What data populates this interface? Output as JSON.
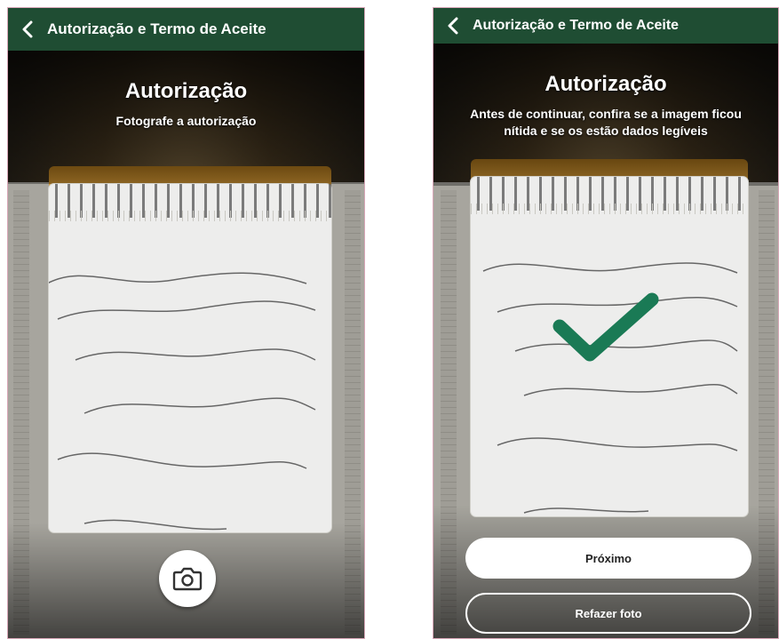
{
  "colors": {
    "header": "#1f4d33",
    "check": "#1a7a55"
  },
  "left_screen": {
    "header": {
      "title": "Autorização e Termo de Aceite",
      "back_icon": "chevron-left-icon"
    },
    "title": "Autorização",
    "subtitle": "Fotografe a autorização",
    "camera_icon": "camera-icon"
  },
  "right_screen": {
    "header": {
      "title": "Autorização e Termo de Aceite",
      "back_icon": "chevron-left-icon"
    },
    "title": "Autorização",
    "subtitle_line1": "Antes de continuar, confira se a imagem ficou",
    "subtitle_line2": "nítida e se os estão dados legíveis",
    "check_icon": "checkmark-icon",
    "next_button": "Próximo",
    "retake_button": "Refazer foto"
  }
}
